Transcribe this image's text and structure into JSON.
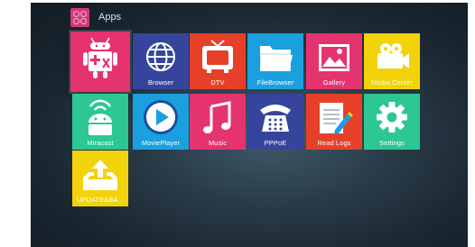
{
  "header": {
    "title": "Apps",
    "icon": "apps-grid-icon"
  },
  "colors": {
    "apk": "#e5336f",
    "browser": "#36459b",
    "dtv": "#e7402a",
    "filebrowser": "#1aa0df",
    "gallery": "#e5336f",
    "mediacenter": "#f2d20a",
    "miracast": "#2cc793",
    "movieplayer": "#1aa0df",
    "music": "#e5336f",
    "pppoe": "#36459b",
    "readlogs": "#e7402a",
    "settings": "#2cc793",
    "update": "#f2d20a"
  },
  "apps": [
    {
      "label": "",
      "icon": "android-apk-installer-icon"
    },
    {
      "label": "Browser",
      "icon": "globe-icon"
    },
    {
      "label": "DTV",
      "icon": "tv-icon"
    },
    {
      "label": "FileBrowser",
      "icon": "folder-icon"
    },
    {
      "label": "Gallery",
      "icon": "picture-icon"
    },
    {
      "label": "Media Center",
      "icon": "video-camera-icon"
    },
    {
      "label": "Miracast",
      "icon": "android-wifi-icon"
    },
    {
      "label": "MoviePlayer",
      "icon": "play-icon"
    },
    {
      "label": "Music",
      "icon": "music-note-icon"
    },
    {
      "label": "PPPoE",
      "icon": "telephone-icon"
    },
    {
      "label": "Read Logs",
      "icon": "notepad-icon"
    },
    {
      "label": "Settings",
      "icon": "gear-icon"
    },
    {
      "label": "UPDATE&BA...",
      "icon": "upload-tray-icon"
    }
  ]
}
